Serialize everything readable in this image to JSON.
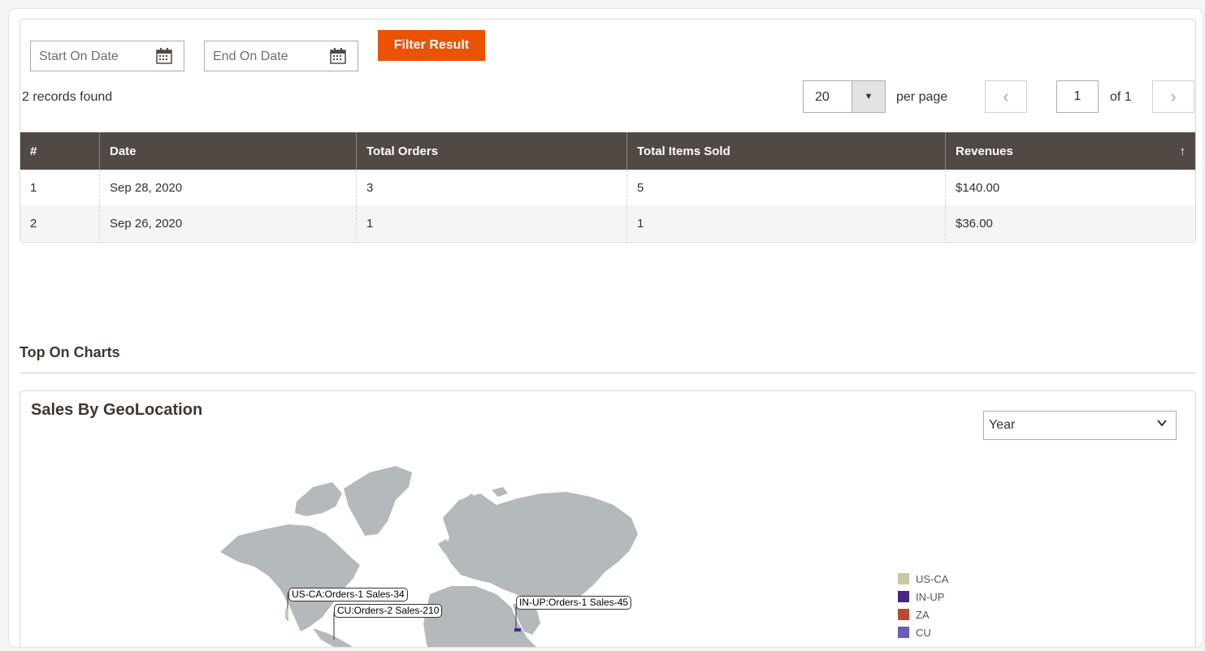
{
  "filters": {
    "start_placeholder": "Start On Date",
    "end_placeholder": "End On Date",
    "filter_button": "Filter Result"
  },
  "grid": {
    "records_found": "2 records found",
    "per_page_value": "20",
    "per_page_label": "per page",
    "current_page": "1",
    "of_pages": "of 1",
    "columns": [
      "#",
      "Date",
      "Total Orders",
      "Total Items Sold",
      "Revenues"
    ],
    "sort_indicator": "↑",
    "rows": [
      {
        "num": "1",
        "date": "Sep 28, 2020",
        "orders": "3",
        "items": "5",
        "revenue": "$140.00"
      },
      {
        "num": "2",
        "date": "Sep 26, 2020",
        "orders": "1",
        "items": "1",
        "revenue": "$36.00"
      }
    ]
  },
  "charts": {
    "section_title": "Top On Charts",
    "geo_title": "Sales By GeoLocation",
    "period_value": "Year",
    "markers": {
      "us_ca": "US-CA:Orders-1 Sales-34",
      "cu": "CU:Orders-2 Sales-210",
      "in_up": "IN-UP:Orders-1 Sales-45"
    },
    "legend": [
      {
        "label": "US-CA",
        "color": "#c8c9a7"
      },
      {
        "label": "IN-UP",
        "color": "#4b2585"
      },
      {
        "label": "ZA",
        "color": "#b94a32"
      },
      {
        "label": "CU",
        "color": "#6a5bb8"
      }
    ]
  },
  "colors": {
    "accent": "#eb5202",
    "header_bg": "#514943",
    "land": "#b4b9bc"
  }
}
